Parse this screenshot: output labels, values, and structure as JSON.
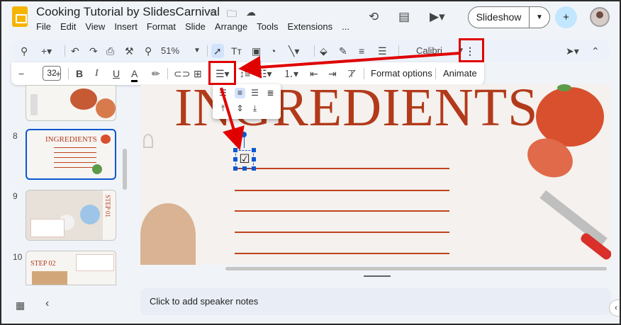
{
  "header": {
    "title": "Cooking Tutorial by SlidesCarnival",
    "menu": [
      "File",
      "Edit",
      "View",
      "Insert",
      "Format",
      "Slide",
      "Arrange",
      "Tools",
      "Extensions",
      "..."
    ],
    "slideshow_label": "Slideshow"
  },
  "toolbar": {
    "zoom": "51%",
    "font": "Calibri"
  },
  "toolbar2": {
    "font_size": "32",
    "format_options": "Format options",
    "animate": "Animate"
  },
  "sidebar": {
    "slides": [
      {
        "number": "8",
        "title": "INGREDIENTS"
      },
      {
        "number": "9",
        "title": "STEP 01"
      },
      {
        "number": "10",
        "title": "STEP 02"
      }
    ]
  },
  "slide": {
    "heading": "INGREDIENTS"
  },
  "notes": {
    "placeholder": "Click to add speaker notes"
  },
  "colors": {
    "accent": "#0b57d0",
    "highlight": "#e00000",
    "slide_red": "#b23a1a"
  }
}
